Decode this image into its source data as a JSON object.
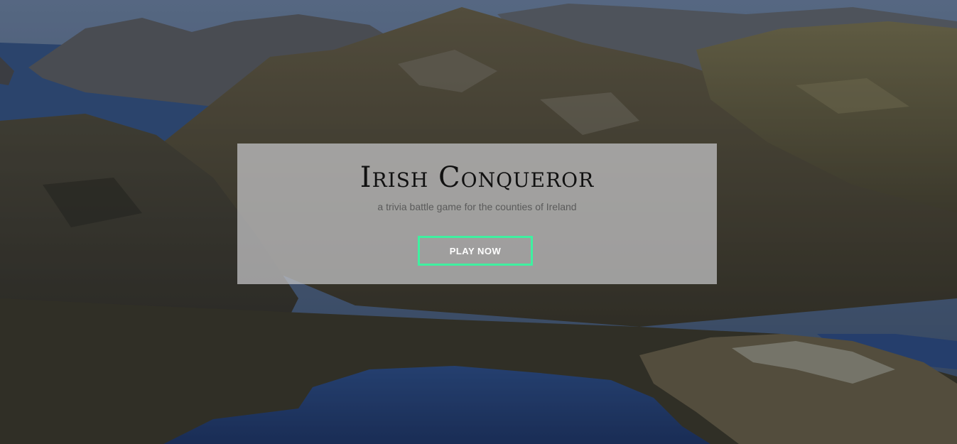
{
  "hero": {
    "title": "Irish Conqueror",
    "subtitle": "a trivia battle game for the counties of Ireland",
    "play_button": "PLAY NOW",
    "background_image": "irish-coastal-mountains-and-lakes-photo"
  },
  "colors": {
    "panel": "#c8c8ca",
    "button_border": "#3ff0a0",
    "button_text": "#ffffff",
    "title": "#111111"
  }
}
